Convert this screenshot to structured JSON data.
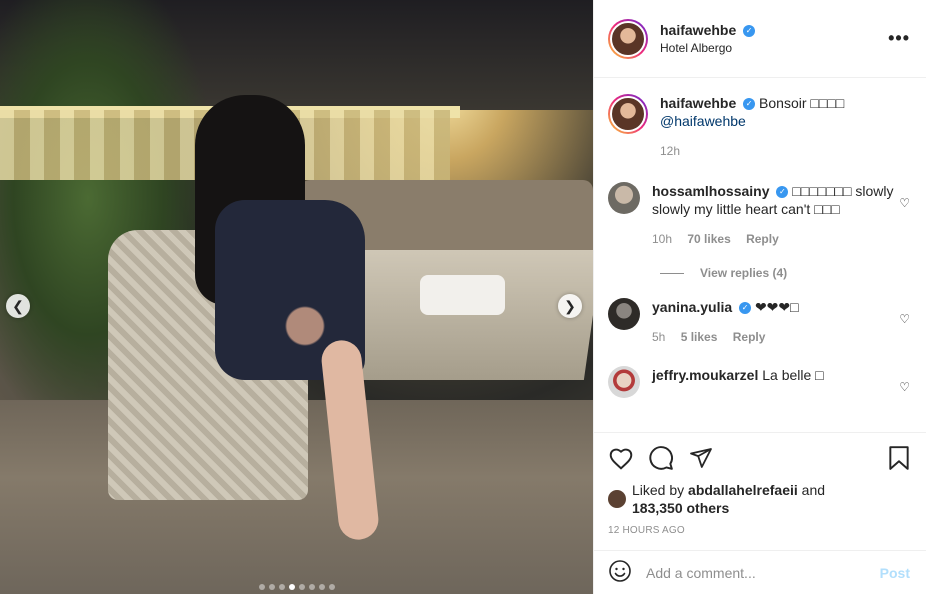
{
  "post": {
    "author": {
      "username": "haifawehbe",
      "location": "Hotel Albergo"
    },
    "caption": {
      "username": "haifawehbe",
      "text": "Bonsoir □□□□",
      "mention": "@haifawehbe",
      "time": "12h"
    },
    "comments": [
      {
        "username": "hossamlhossainy",
        "text": "□□□□□□□ slowly slowly my little heart can't □□□",
        "time": "10h",
        "likes": "70 likes",
        "reply": "Reply"
      },
      {
        "username": "yanina.yulia",
        "text": "❤❤❤□",
        "time": "5h",
        "likes": "5 likes",
        "reply": "Reply"
      },
      {
        "username": "jeffry.moukarzel",
        "text": "La belle □"
      }
    ],
    "view_replies": "View replies (4)",
    "liked_by_prefix": "Liked by",
    "liked_by_user": "abdallahelrefaeii",
    "liked_by_and": "and",
    "liked_by_others": "183,350 others",
    "timestamp": "12 HOURS AGO",
    "comment_placeholder": "Add a comment...",
    "post_label": "Post",
    "more_label": "•••"
  },
  "carousel": {
    "prev_icon": "chevron-left-icon",
    "next_icon": "chevron-right-icon",
    "total_slides": 8,
    "active_slide": 4
  },
  "colors": {
    "verified": "#3897f0",
    "link": "#00376b",
    "muted": "#8e8e8e",
    "post_disabled": "#b2dffc"
  }
}
